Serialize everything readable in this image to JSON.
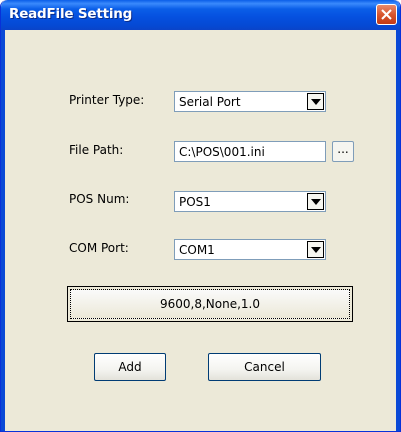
{
  "window": {
    "title": "ReadFile Setting"
  },
  "form": {
    "printer_type": {
      "label": "Printer Type:",
      "value": "Serial Port"
    },
    "file_path": {
      "label": "File Path:",
      "value": "C:\\POS\\001.ini",
      "browse_label": "..."
    },
    "pos_num": {
      "label": "POS Num:",
      "value": "POS1"
    },
    "com_port": {
      "label": "COM Port:",
      "value": "COM1"
    },
    "serial_settings": "9600,8,None,1.0"
  },
  "buttons": {
    "add": "Add",
    "cancel": "Cancel"
  },
  "icons": {
    "close": "close-icon",
    "dropdown": "chevron-down-icon"
  },
  "colors": {
    "titlebar": "#0a5ee8",
    "client": "#ece9d8",
    "close": "#d8562e"
  }
}
